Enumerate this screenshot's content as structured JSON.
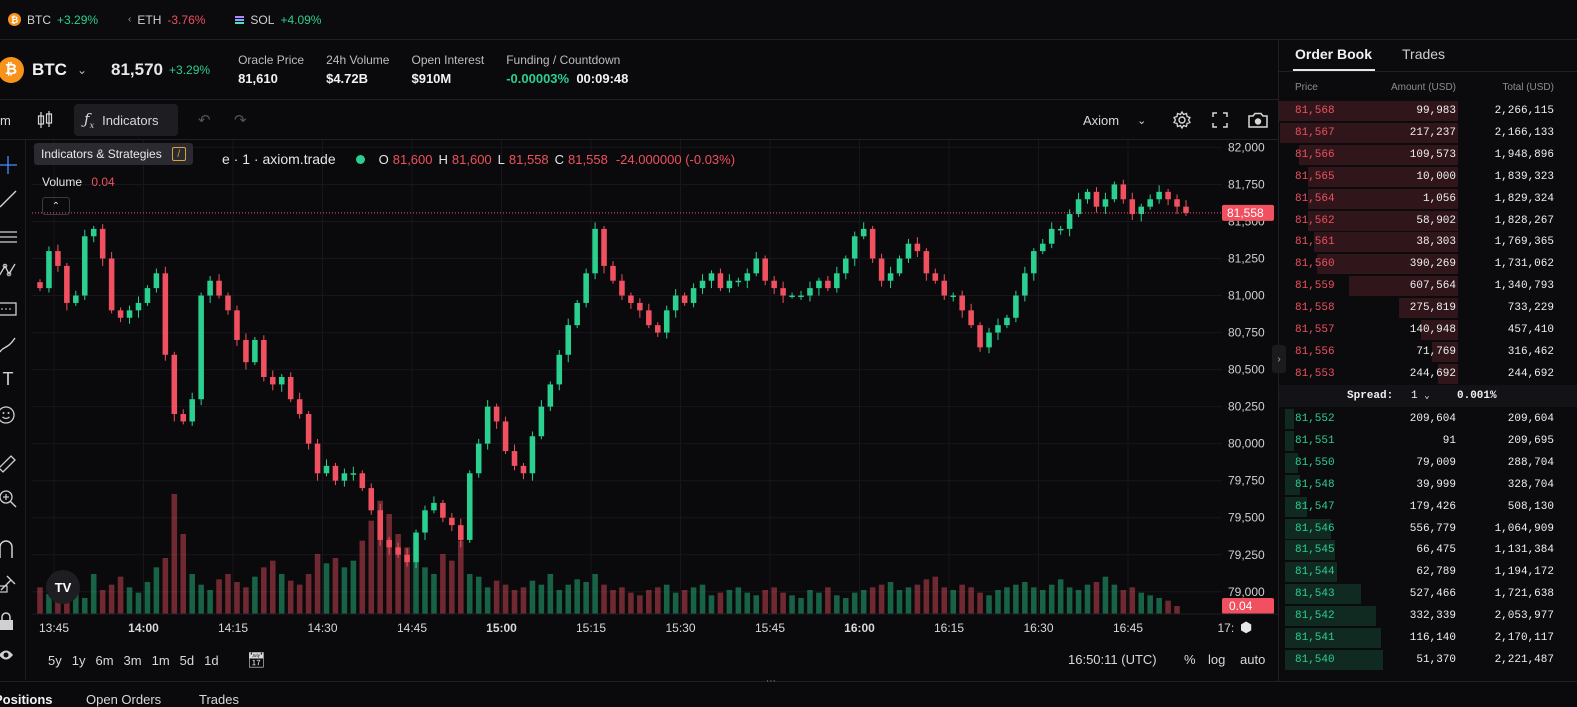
{
  "ticker": [
    {
      "sym": "BTC",
      "chg": "+3.29%",
      "dir": "up",
      "icon": "btc-coin-icon"
    },
    {
      "sym": "ETH",
      "chg": "-3.76%",
      "dir": "down",
      "icon": "eth-icon"
    },
    {
      "sym": "SOL",
      "chg": "+4.09%",
      "dir": "up",
      "icon": "sol-icon"
    }
  ],
  "market": {
    "logo": "₿",
    "symbol": "BTC",
    "price": "81,570",
    "change": "+3.29%",
    "stats": [
      {
        "label": "Oracle Price",
        "value": "81,610",
        "color": ""
      },
      {
        "label": "24h Volume",
        "value": "$4.72B",
        "color": ""
      },
      {
        "label": "Open Interest",
        "value": "$910M",
        "color": ""
      },
      {
        "label": "Funding / Countdown",
        "value": "-0.00003%",
        "value2": "00:09:48",
        "color": "up"
      }
    ]
  },
  "toolbar": {
    "interval": "m",
    "indicators_label": "Indicators",
    "tooltip": "Indicators & Strategies",
    "tooltip_key": "/",
    "chart_source": "Axiom"
  },
  "legend": {
    "title": "e · 1 · axiom.trade",
    "o_label": "O",
    "o": "81,600",
    "h_label": "H",
    "h": "81,600",
    "l_label": "L",
    "l": "81,558",
    "c_label": "C",
    "c": "81,558",
    "change": "-24.000000 (-0.03%)",
    "volume_label": "Volume",
    "volume_value": "0.04"
  },
  "chart_data": {
    "type": "candlestick",
    "title": "",
    "xlabel": "",
    "ylabel": "",
    "ylim": [
      78850,
      82050
    ],
    "yticks": [
      "82,000",
      "81,750",
      "81,500",
      "81,250",
      "81,000",
      "80,750",
      "80,500",
      "80,250",
      "80,000",
      "79,750",
      "79,500",
      "79,250",
      "79,000"
    ],
    "ytick_values": [
      82000,
      81750,
      81500,
      81250,
      81000,
      80750,
      80500,
      80250,
      80000,
      79750,
      79500,
      79250,
      79000
    ],
    "xticks": [
      "13:45",
      "14:00",
      "14:15",
      "14:30",
      "14:45",
      "15:00",
      "15:15",
      "15:30",
      "15:45",
      "16:00",
      "16:15",
      "16:30",
      "16:45",
      "17:"
    ],
    "xticks_bold": [
      false,
      true,
      false,
      false,
      false,
      true,
      false,
      false,
      false,
      true,
      false,
      false,
      false,
      false
    ],
    "last_price_label": "81,558",
    "last_price": 81558,
    "volume_label": "0.04",
    "closes": [
      81050,
      81300,
      81200,
      80950,
      81000,
      81400,
      81450,
      81250,
      80900,
      80850,
      80900,
      80950,
      81050,
      81150,
      80600,
      80200,
      80150,
      80300,
      81000,
      81100,
      81000,
      80900,
      80700,
      80550,
      80700,
      80450,
      80400,
      80450,
      80300,
      80200,
      80000,
      79800,
      79850,
      79750,
      79800,
      79800,
      79700,
      79550,
      79350,
      79300,
      79250,
      79200,
      79400,
      79550,
      79600,
      79500,
      79450,
      79350,
      79800,
      80000,
      80250,
      80150,
      79950,
      79850,
      79800,
      80050,
      80250,
      80400,
      80600,
      80800,
      80950,
      81150,
      81450,
      81200,
      81100,
      81000,
      80950,
      80900,
      80800,
      80750,
      80900,
      81000,
      80950,
      81050,
      81100,
      81150,
      81050,
      81100,
      81100,
      81150,
      81250,
      81100,
      81050,
      81000,
      81000,
      81000,
      81050,
      81100,
      81050,
      81150,
      81250,
      81400,
      81450,
      81250,
      81100,
      81150,
      81250,
      81350,
      81300,
      81150,
      81100,
      81000,
      81000,
      80900,
      80800,
      80650,
      80750,
      80800,
      80850,
      81000,
      81150,
      81300,
      81350,
      81450,
      81450,
      81550,
      81650,
      81700,
      81600,
      81650,
      81750,
      81650,
      81550,
      81600,
      81650,
      81700,
      81650,
      81600,
      81558
    ],
    "volumes": [
      20,
      15,
      18,
      25,
      22,
      12,
      30,
      18,
      22,
      28,
      20,
      16,
      24,
      35,
      42,
      90,
      60,
      30,
      22,
      18,
      26,
      30,
      24,
      20,
      28,
      35,
      40,
      30,
      25,
      22,
      30,
      45,
      38,
      42,
      35,
      40,
      55,
      70,
      85,
      75,
      60,
      50,
      40,
      35,
      30,
      45,
      40,
      55,
      30,
      28,
      20,
      25,
      22,
      18,
      20,
      25,
      22,
      30,
      18,
      22,
      26,
      24,
      30,
      22,
      18,
      20,
      16,
      14,
      18,
      20,
      22,
      16,
      18,
      20,
      22,
      14,
      16,
      18,
      20,
      16,
      14,
      18,
      20,
      16,
      14,
      12,
      18,
      16,
      20,
      14,
      12,
      16,
      18,
      20,
      22,
      24,
      18,
      20,
      22,
      26,
      28,
      20,
      18,
      22,
      20,
      16,
      14,
      18,
      20,
      22,
      24,
      20,
      18,
      22,
      26,
      20,
      18,
      22,
      24,
      28,
      22,
      18,
      20,
      16,
      14,
      12,
      10,
      6
    ]
  },
  "ranges": [
    "5y",
    "1y",
    "6m",
    "3m",
    "1m",
    "5d",
    "1d"
  ],
  "clock": "16:50:11 (UTC)",
  "scale_opts": [
    "%",
    "log",
    "auto"
  ],
  "bottom_tabs": [
    "Positions",
    "Open Orders",
    "Trades"
  ],
  "orderbook": {
    "tabs": [
      "Order Book",
      "Trades"
    ],
    "headers": [
      "Price",
      "Amount (USD)",
      "Total (USD)"
    ],
    "asks": [
      {
        "price": "81,568",
        "amount": "99,983",
        "total": "2,266,115",
        "depth": 1.0
      },
      {
        "price": "81,567",
        "amount": "217,237",
        "total": "2,166,133",
        "depth": 0.96
      },
      {
        "price": "81,566",
        "amount": "109,573",
        "total": "1,948,896",
        "depth": 0.86
      },
      {
        "price": "81,565",
        "amount": "10,000",
        "total": "1,839,323",
        "depth": 0.81
      },
      {
        "price": "81,564",
        "amount": "1,056",
        "total": "1,829,324",
        "depth": 0.81
      },
      {
        "price": "81,562",
        "amount": "58,902",
        "total": "1,828,267",
        "depth": 0.81
      },
      {
        "price": "81,561",
        "amount": "38,303",
        "total": "1,769,365",
        "depth": 0.78
      },
      {
        "price": "81,560",
        "amount": "390,269",
        "total": "1,731,062",
        "depth": 0.76
      },
      {
        "price": "81,559",
        "amount": "607,564",
        "total": "1,340,793",
        "depth": 0.59
      },
      {
        "price": "81,558",
        "amount": "275,819",
        "total": "733,229",
        "depth": 0.32
      },
      {
        "price": "81,557",
        "amount": "140,948",
        "total": "457,410",
        "depth": 0.2
      },
      {
        "price": "81,556",
        "amount": "71,769",
        "total": "316,462",
        "depth": 0.14
      },
      {
        "price": "81,553",
        "amount": "244,692",
        "total": "244,692",
        "depth": 0.11
      }
    ],
    "spread_label": "Spread:",
    "spread_step": "1",
    "spread_value": "0.001%",
    "bids": [
      {
        "price": "81,552",
        "amount": "209,604",
        "total": "209,604",
        "depth": 0.05
      },
      {
        "price": "81,551",
        "amount": "91",
        "total": "209,695",
        "depth": 0.05
      },
      {
        "price": "81,550",
        "amount": "79,009",
        "total": "288,704",
        "depth": 0.07
      },
      {
        "price": "81,548",
        "amount": "39,999",
        "total": "328,704",
        "depth": 0.08
      },
      {
        "price": "81,547",
        "amount": "179,426",
        "total": "508,130",
        "depth": 0.12
      },
      {
        "price": "81,546",
        "amount": "556,779",
        "total": "1,064,909",
        "depth": 0.25
      },
      {
        "price": "81,545",
        "amount": "66,475",
        "total": "1,131,384",
        "depth": 0.27
      },
      {
        "price": "81,544",
        "amount": "62,789",
        "total": "1,194,172",
        "depth": 0.28
      },
      {
        "price": "81,543",
        "amount": "527,466",
        "total": "1,721,638",
        "depth": 0.41
      },
      {
        "price": "81,542",
        "amount": "332,339",
        "total": "2,053,977",
        "depth": 0.49
      },
      {
        "price": "81,541",
        "amount": "116,140",
        "total": "2,170,117",
        "depth": 0.52
      },
      {
        "price": "81,540",
        "amount": "51,370",
        "total": "2,221,487",
        "depth": 0.53
      }
    ]
  },
  "colors": {
    "up": "#2bcf8f",
    "down": "#f0505f",
    "bg": "#0a0a0c"
  }
}
